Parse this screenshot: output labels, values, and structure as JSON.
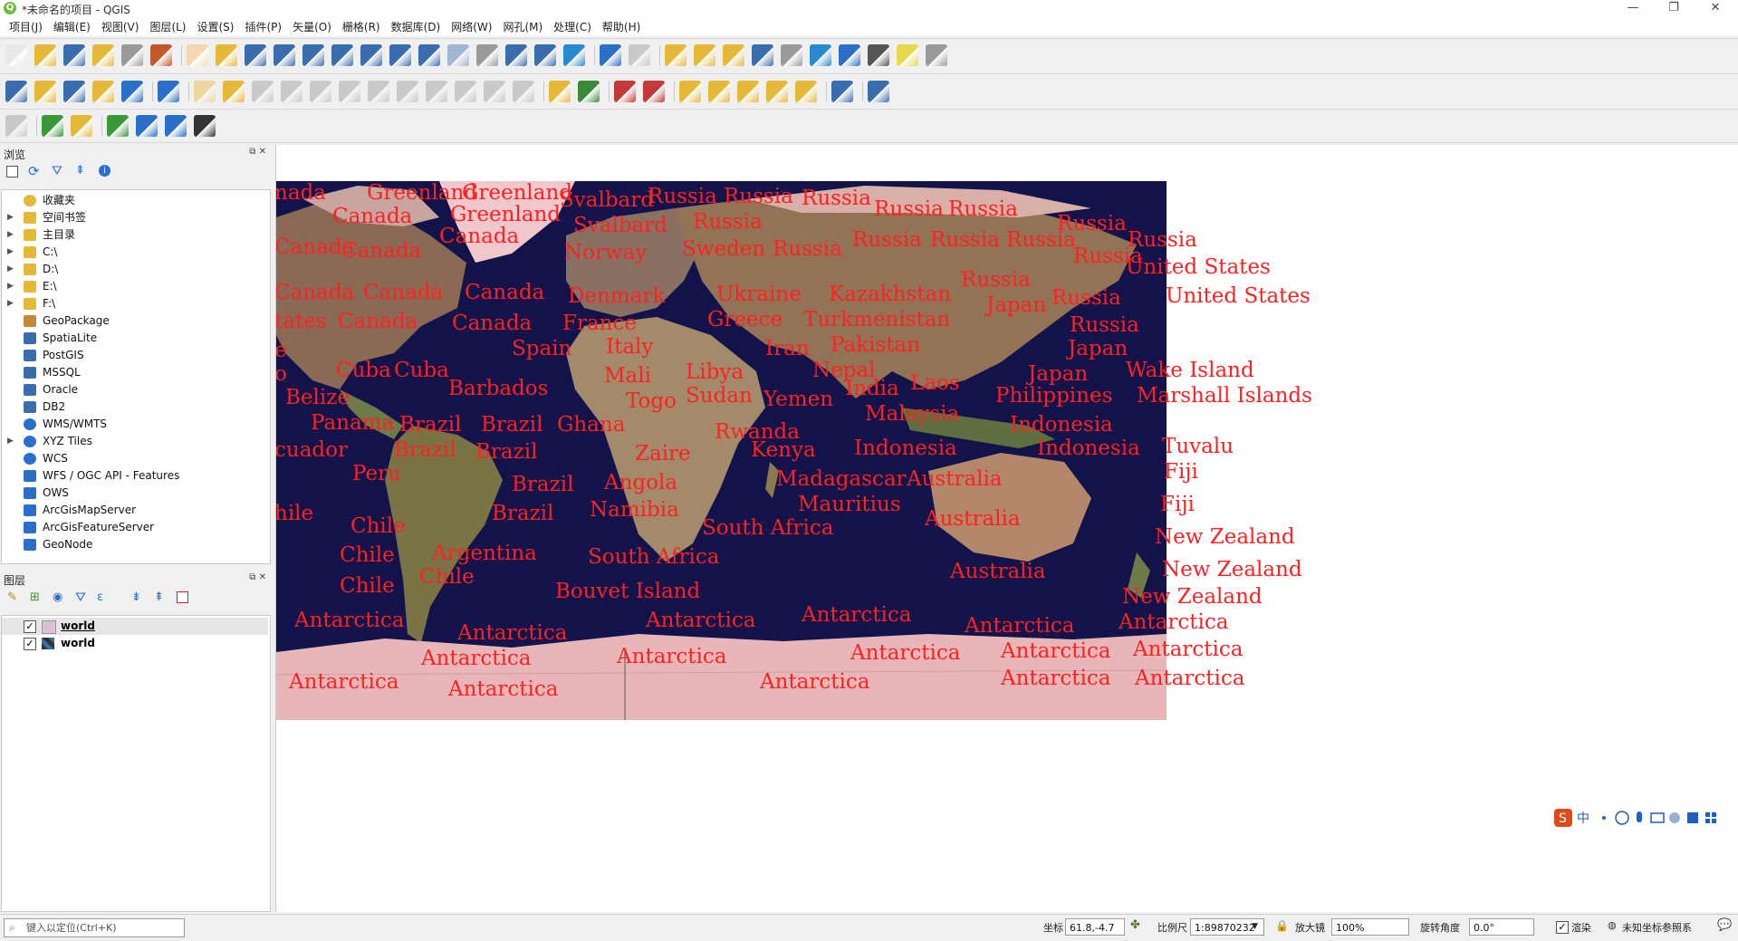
{
  "window": {
    "title": "*未命名的项目 - QGIS"
  },
  "menu": [
    "项目(J)",
    "编辑(E)",
    "视图(V)",
    "图层(L)",
    "设置(S)",
    "插件(P)",
    "矢量(O)",
    "栅格(R)",
    "数据库(D)",
    "网络(W)",
    "网孔(M)",
    "处理(C)",
    "帮助(H)"
  ],
  "browser": {
    "title": "浏览",
    "items": [
      {
        "label": "收藏夹",
        "icon": "star-icon",
        "expandable": false
      },
      {
        "label": "空间书签",
        "icon": "bookmark-folder-icon",
        "expandable": true
      },
      {
        "label": "主目录",
        "icon": "home-folder-icon",
        "expandable": true
      },
      {
        "label": "C:\\",
        "icon": "drive-folder-icon",
        "expandable": true
      },
      {
        "label": "D:\\",
        "icon": "drive-folder-icon",
        "expandable": true
      },
      {
        "label": "E:\\",
        "icon": "drive-folder-icon",
        "expandable": true
      },
      {
        "label": "F:\\",
        "icon": "drive-folder-icon",
        "expandable": true
      },
      {
        "label": "GeoPackage",
        "icon": "geopackage-icon",
        "expandable": false
      },
      {
        "label": "SpatiaLite",
        "icon": "spatialite-icon",
        "expandable": false
      },
      {
        "label": "PostGIS",
        "icon": "postgis-icon",
        "expandable": false
      },
      {
        "label": "MSSQL",
        "icon": "mssql-icon",
        "expandable": false
      },
      {
        "label": "Oracle",
        "icon": "oracle-icon",
        "expandable": false
      },
      {
        "label": "DB2",
        "icon": "db2-icon",
        "expandable": false
      },
      {
        "label": "WMS/WMTS",
        "icon": "globe-icon",
        "expandable": false
      },
      {
        "label": "XYZ Tiles",
        "icon": "globe-icon",
        "expandable": true
      },
      {
        "label": "WCS",
        "icon": "globe-icon",
        "expandable": false
      },
      {
        "label": "WFS / OGC API - Features",
        "icon": "wfs-icon",
        "expandable": false
      },
      {
        "label": "OWS",
        "icon": "ows-icon",
        "expandable": false
      },
      {
        "label": "ArcGisMapServer",
        "icon": "arcgis-icon",
        "expandable": false
      },
      {
        "label": "ArcGisFeatureServer",
        "icon": "arcgis-icon",
        "expandable": false
      },
      {
        "label": "GeoNode",
        "icon": "geonode-icon",
        "expandable": false
      }
    ]
  },
  "layers_panel": {
    "title": "图层",
    "layers": [
      {
        "name": "world",
        "checked": true,
        "type": "vector",
        "selected": true
      },
      {
        "name": "world",
        "checked": true,
        "type": "raster",
        "selected": false
      }
    ]
  },
  "map_labels": [
    [
      "nada",
      -2,
      0
    ],
    [
      "Greenland",
      100,
      0
    ],
    [
      "Greenland",
      205,
      0
    ],
    [
      "Svalbard",
      313,
      8
    ],
    [
      "Russia",
      410,
      4
    ],
    [
      "Russia",
      494,
      4
    ],
    [
      "Russia",
      580,
      6
    ],
    [
      "Russia",
      660,
      18
    ],
    [
      "Russia",
      742,
      18
    ],
    [
      "Canada",
      62,
      26
    ],
    [
      "Greenland",
      192,
      24
    ],
    [
      "Svalbard",
      328,
      36
    ],
    [
      "Russia",
      460,
      32
    ],
    [
      "Russia",
      862,
      34
    ],
    [
      "Canada",
      -2,
      60
    ],
    [
      "Canada",
      72,
      64
    ],
    [
      "Canada",
      180,
      48
    ],
    [
      "Norway",
      318,
      66
    ],
    [
      "Sweden",
      448,
      62
    ],
    [
      "Russia",
      548,
      62
    ],
    [
      "Russia",
      636,
      52
    ],
    [
      "Russia",
      722,
      52
    ],
    [
      "Russia",
      940,
      52
    ],
    [
      "Russia",
      806,
      52
    ],
    [
      "Russia",
      756,
      96
    ],
    [
      "Russia",
      880,
      70
    ],
    [
      "United States",
      938,
      82
    ],
    [
      "Russia",
      856,
      116
    ],
    [
      "Canada",
      -2,
      110
    ],
    [
      "Canada",
      96,
      110
    ],
    [
      "Canada",
      208,
      110
    ],
    [
      "Denmark",
      322,
      114
    ],
    [
      "Ukraine",
      486,
      112
    ],
    [
      "Kazakhstan",
      610,
      112
    ],
    [
      "Japan",
      784,
      124
    ],
    [
      "United States",
      982,
      114
    ],
    [
      "tates",
      -2,
      142
    ],
    [
      "Canada",
      68,
      142
    ],
    [
      "Canada",
      194,
      144
    ],
    [
      "France",
      316,
      144
    ],
    [
      "Greece",
      476,
      140
    ],
    [
      "Turkmenistan",
      582,
      140
    ],
    [
      "Russia",
      876,
      146
    ],
    [
      "e",
      -2,
      174
    ],
    [
      "Spain",
      260,
      172
    ],
    [
      "Italy",
      364,
      170
    ],
    [
      "Iran",
      540,
      172
    ],
    [
      "Pakistan",
      612,
      168
    ],
    [
      "Japan",
      874,
      172
    ],
    [
      "Cuba",
      66,
      196
    ],
    [
      "Cuba",
      130,
      196
    ],
    [
      "o",
      -2,
      200
    ],
    [
      "Mali",
      362,
      202
    ],
    [
      "Libya",
      452,
      198
    ],
    [
      "Nepal",
      592,
      196
    ],
    [
      "Japan",
      830,
      200
    ],
    [
      "Wake Island",
      938,
      196
    ],
    [
      "Barbados",
      190,
      216
    ],
    [
      "Togo",
      386,
      230
    ],
    [
      "Sudan",
      452,
      224
    ],
    [
      "Yemen",
      538,
      228
    ],
    [
      "India",
      628,
      216
    ],
    [
      "Laos",
      700,
      210
    ],
    [
      "Philippines",
      794,
      224
    ],
    [
      "Marshall Islands",
      950,
      224
    ],
    [
      "Belize",
      10,
      226
    ],
    [
      "Malaysia",
      650,
      244
    ],
    [
      "Indonesia",
      810,
      256
    ],
    [
      "Panama",
      38,
      254
    ],
    [
      "Brazil",
      136,
      256
    ],
    [
      "Brazil",
      226,
      256
    ],
    [
      "Ghana",
      310,
      256
    ],
    [
      "Rwanda",
      484,
      264
    ],
    [
      "cuador",
      -2,
      284
    ],
    [
      "Brazil",
      130,
      284
    ],
    [
      "Brazil",
      220,
      286
    ],
    [
      "Zaire",
      396,
      288
    ],
    [
      "Kenya",
      524,
      284
    ],
    [
      "Indonesia",
      638,
      282
    ],
    [
      "Indonesia",
      840,
      282
    ],
    [
      "Tuvalu",
      978,
      280
    ],
    [
      "Peru",
      84,
      310
    ],
    [
      "Brazil",
      260,
      322
    ],
    [
      "Angola",
      362,
      320
    ],
    [
      "Madagascar",
      552,
      316
    ],
    [
      "Australia",
      696,
      316
    ],
    [
      "Fiji",
      980,
      308
    ],
    [
      "Mauritius",
      576,
      344
    ],
    [
      "hile",
      -2,
      354
    ],
    [
      "Namibia",
      346,
      350
    ],
    [
      "Brazil",
      238,
      354
    ],
    [
      "Fiji",
      976,
      344
    ],
    [
      "Chile",
      82,
      368
    ],
    [
      "South Africa",
      470,
      370
    ],
    [
      "Australia",
      716,
      360
    ],
    [
      "New Zealand",
      970,
      380
    ],
    [
      "Chile",
      70,
      400
    ],
    [
      "Argentina",
      172,
      398
    ],
    [
      "South Africa",
      344,
      402
    ],
    [
      "Australia",
      744,
      418
    ],
    [
      "New Zealand",
      978,
      416
    ],
    [
      "Chile",
      70,
      434
    ],
    [
      "Chile",
      158,
      424
    ],
    [
      "Bouvet Island",
      308,
      440
    ],
    [
      "New Zealand",
      934,
      446
    ],
    [
      "Antarctica",
      20,
      472
    ],
    [
      "Antarctica",
      408,
      472
    ],
    [
      "Antarctica",
      580,
      466
    ],
    [
      "Antarctica",
      760,
      478
    ],
    [
      "Antarctica",
      930,
      474
    ],
    [
      "Antarctica",
      200,
      486
    ],
    [
      "Antarctica",
      160,
      514
    ],
    [
      "Antarctica",
      376,
      512
    ],
    [
      "Antarctica",
      634,
      508
    ],
    [
      "Antarctica",
      800,
      506
    ],
    [
      "Antarctica",
      946,
      504
    ],
    [
      "Antarctica",
      14,
      540
    ],
    [
      "Antarctica",
      190,
      548
    ],
    [
      "Antarctica",
      534,
      540
    ],
    [
      "Antarctica",
      800,
      536
    ],
    [
      "Antarctica",
      948,
      536
    ]
  ],
  "status": {
    "locator_placeholder": "键入以定位(Ctrl+K)",
    "coord_label": "坐标",
    "coord_value": "61.8,-4.7",
    "scale_label": "比例尺",
    "scale_value": "1:89870232",
    "magnifier_label": "放大镜",
    "magnifier_value": "100%",
    "rotation_label": "旋转角度",
    "rotation_value": "0.0°",
    "render_label": "渲染",
    "crs_label": "未知坐标参照系"
  },
  "colors": {
    "map_label": "#ff2020",
    "ocean": "#11134a"
  }
}
